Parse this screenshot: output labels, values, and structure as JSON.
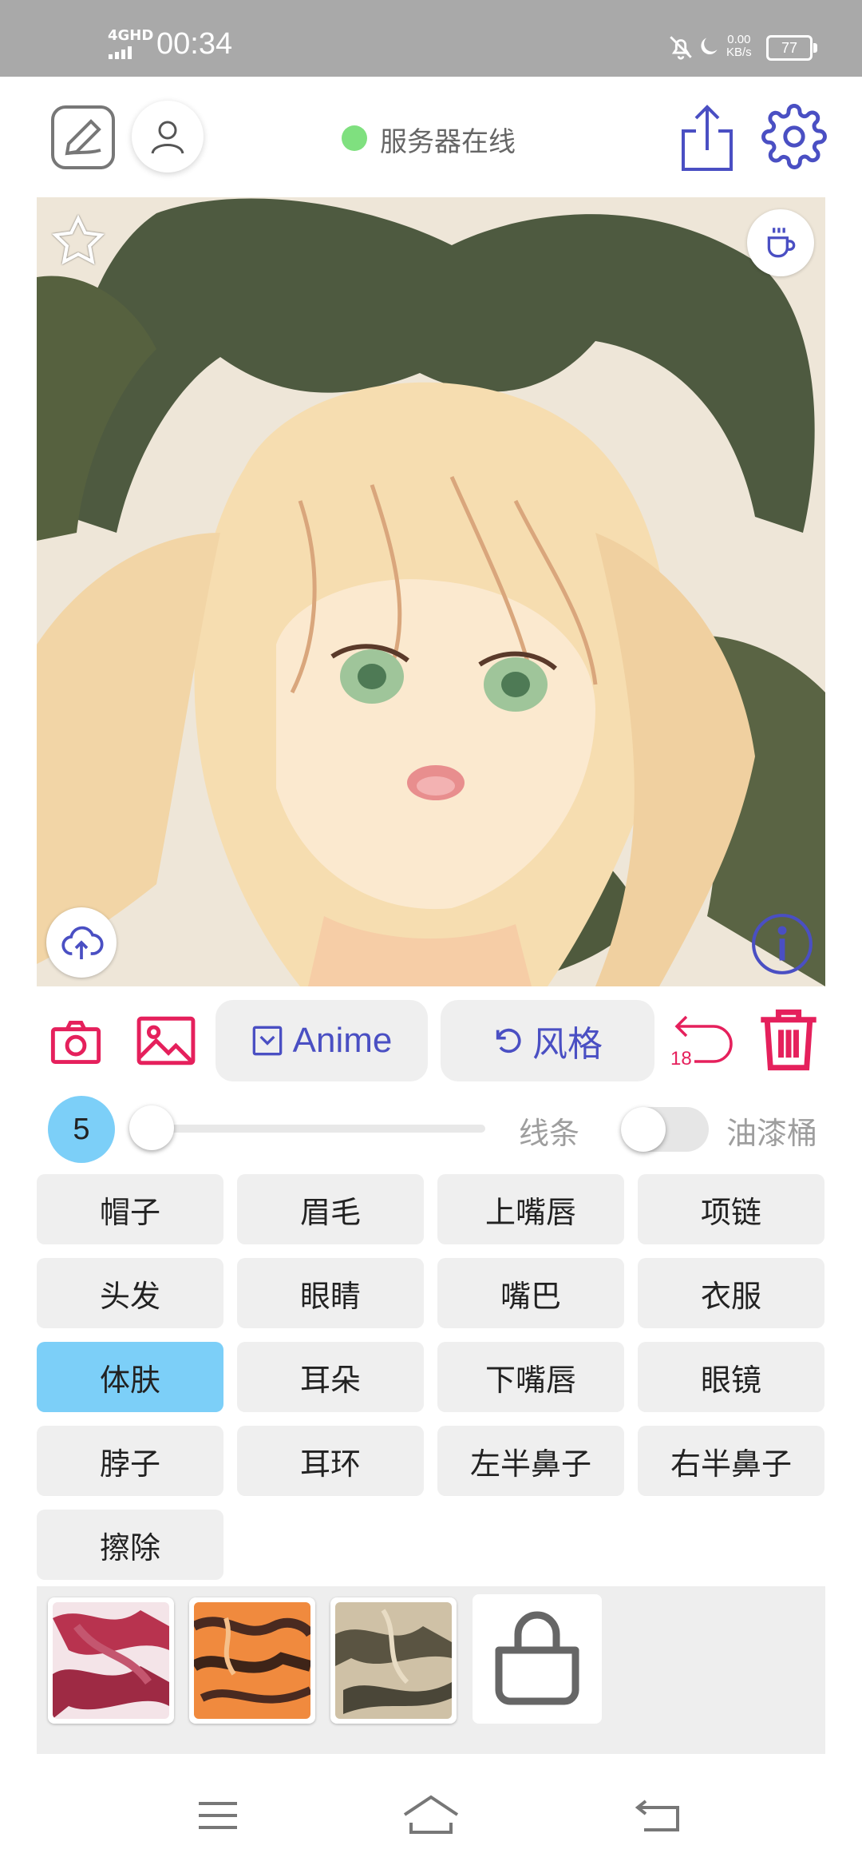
{
  "status_bar": {
    "network": "4GHD",
    "time": "00:34",
    "speed_value": "0.00",
    "speed_unit": "KB/s",
    "battery": "77"
  },
  "header": {
    "server_status": "服务器在线",
    "server_status_color": "#7fe07f",
    "icons": [
      "edit-icon",
      "user-icon",
      "share-icon",
      "settings-icon"
    ]
  },
  "canvas": {
    "overlay_icons": [
      "star-icon",
      "coffee-icon",
      "cloud-upload-icon",
      "info-icon"
    ]
  },
  "toolbar": {
    "model_label": "Anime",
    "style_label": "风格",
    "undo_count": "18",
    "accent_color": "#4a4fc3",
    "tool_color": "#e5205c"
  },
  "brush": {
    "size": "5",
    "line_label": "线条",
    "bucket_label": "油漆桶"
  },
  "parts": [
    {
      "label": "帽子"
    },
    {
      "label": "眉毛"
    },
    {
      "label": "上嘴唇"
    },
    {
      "label": "项链"
    },
    {
      "label": "头发"
    },
    {
      "label": "眼睛"
    },
    {
      "label": "嘴巴"
    },
    {
      "label": "衣服"
    },
    {
      "label": "体肤",
      "active": true
    },
    {
      "label": "耳朵"
    },
    {
      "label": "下嘴唇"
    },
    {
      "label": "眼镜"
    },
    {
      "label": "脖子"
    },
    {
      "label": "耳环"
    },
    {
      "label": "左半鼻子"
    },
    {
      "label": "右半鼻子"
    },
    {
      "label": "擦除"
    }
  ],
  "swatches": [
    "swatch-red-pattern",
    "swatch-orange-tiger",
    "swatch-beige-camo",
    "shop-bag-icon"
  ]
}
